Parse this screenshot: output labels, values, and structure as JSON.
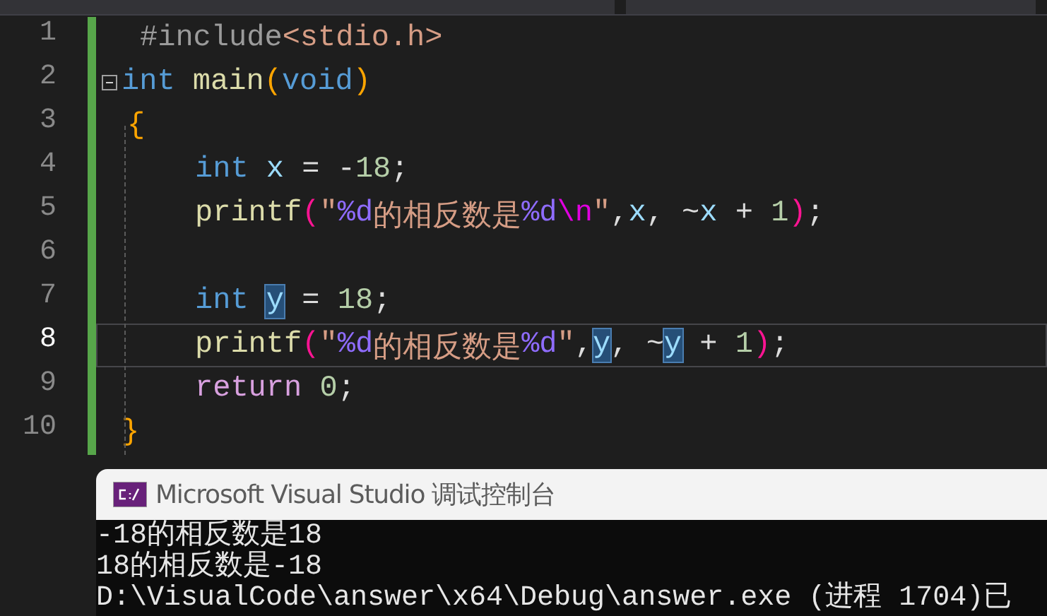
{
  "editor": {
    "lines": [
      {
        "number": "1",
        "current": false,
        "kind": "directive",
        "tokens": [
          {
            "kind": "preproc",
            "text": "#include"
          },
          {
            "kind": "string",
            "text": "<stdio.h>"
          }
        ]
      },
      {
        "number": "2",
        "current": false,
        "kind": "signature",
        "collapsible": true,
        "tokens": [
          {
            "kind": "keyword",
            "text": "int "
          },
          {
            "kind": "func",
            "text": "main"
          },
          {
            "kind": "paren1",
            "text": "("
          },
          {
            "kind": "keyword",
            "text": "void"
          },
          {
            "kind": "paren1",
            "text": ")"
          }
        ]
      },
      {
        "number": "3",
        "current": false,
        "kind": "open",
        "tokens": [
          {
            "kind": "brace",
            "text": "{"
          }
        ]
      },
      {
        "number": "4",
        "current": false,
        "kind": "body",
        "tokens": [
          {
            "kind": "keyword",
            "text": "int "
          },
          {
            "kind": "ident",
            "text": "x"
          },
          {
            "kind": "plain",
            "text": " = -"
          },
          {
            "kind": "number",
            "text": "18"
          },
          {
            "kind": "plain",
            "text": ";"
          }
        ]
      },
      {
        "number": "5",
        "current": false,
        "kind": "body",
        "tokens": [
          {
            "kind": "func",
            "text": "printf"
          },
          {
            "kind": "paren2",
            "text": "("
          },
          {
            "kind": "string",
            "text": "\""
          },
          {
            "kind": "format",
            "text": "%d"
          },
          {
            "kind": "string",
            "text": "的相反数是"
          },
          {
            "kind": "format",
            "text": "%d"
          },
          {
            "kind": "escape",
            "text": "\\n"
          },
          {
            "kind": "string",
            "text": "\""
          },
          {
            "kind": "plain",
            "text": ","
          },
          {
            "kind": "ident",
            "text": "x"
          },
          {
            "kind": "plain",
            "text": ", ~"
          },
          {
            "kind": "ident",
            "text": "x"
          },
          {
            "kind": "plain",
            "text": " + "
          },
          {
            "kind": "number",
            "text": "1"
          },
          {
            "kind": "paren2",
            "text": ")"
          },
          {
            "kind": "plain",
            "text": ";"
          }
        ]
      },
      {
        "number": "6",
        "current": false,
        "kind": "blank"
      },
      {
        "number": "7",
        "current": false,
        "kind": "body",
        "tokens": [
          {
            "kind": "keyword",
            "text": "int "
          },
          {
            "kind": "ident",
            "text": "y",
            "highlighted": true
          },
          {
            "kind": "plain",
            "text": " = "
          },
          {
            "kind": "number",
            "text": "18"
          },
          {
            "kind": "plain",
            "text": ";"
          }
        ]
      },
      {
        "number": "8",
        "current": true,
        "kind": "body",
        "tokens": [
          {
            "kind": "func",
            "text": "printf"
          },
          {
            "kind": "paren2",
            "text": "("
          },
          {
            "kind": "string",
            "text": "\""
          },
          {
            "kind": "format",
            "text": "%d"
          },
          {
            "kind": "string",
            "text": "的相反数是"
          },
          {
            "kind": "format",
            "text": "%d"
          },
          {
            "kind": "string",
            "text": "\""
          },
          {
            "kind": "plain",
            "text": ","
          },
          {
            "kind": "ident",
            "text": "y",
            "highlighted": true
          },
          {
            "kind": "plain",
            "text": ", ~"
          },
          {
            "kind": "ident",
            "text": "y",
            "highlighted": true
          },
          {
            "kind": "plain",
            "text": " + "
          },
          {
            "kind": "number",
            "text": "1"
          },
          {
            "kind": "paren2",
            "text": ")"
          },
          {
            "kind": "plain",
            "text": ";"
          }
        ]
      },
      {
        "number": "9",
        "current": false,
        "kind": "body",
        "tokens": [
          {
            "kind": "control",
            "text": "return "
          },
          {
            "kind": "number",
            "text": "0"
          },
          {
            "kind": "plain",
            "text": ";"
          }
        ]
      },
      {
        "number": "10",
        "current": false,
        "kind": "close",
        "tokens": [
          {
            "kind": "brace",
            "text": "}"
          }
        ]
      }
    ]
  },
  "console": {
    "title": "Microsoft Visual Studio 调试控制台",
    "output": [
      "-18的相反数是18",
      "18的相反数是-18",
      "D:\\VisualCode\\answer\\x64\\Debug\\answer.exe (进程 1704)已"
    ]
  }
}
